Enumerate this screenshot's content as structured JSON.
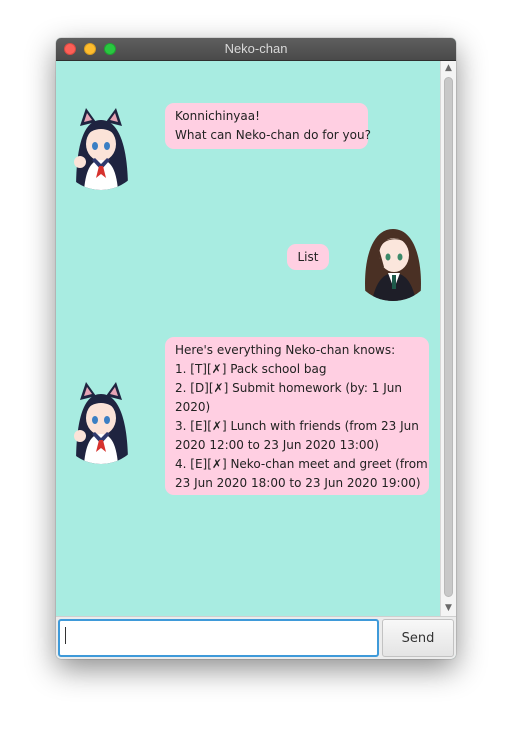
{
  "window": {
    "title": "Neko-chan"
  },
  "messages": [
    {
      "sender": "bot",
      "lines": [
        "Konnichinyaa!",
        "What can Neko-chan do for you?"
      ]
    },
    {
      "sender": "user",
      "lines": [
        "List"
      ]
    },
    {
      "sender": "bot",
      "lines": [
        "Here's everything Neko-chan knows:",
        "1. [T][✗] Pack school bag",
        "2. [D][✗] Submit homework (by: 1 Jun",
        "2020)",
        "3. [E][✗] Lunch with friends (from 23 Jun",
        "2020 12:00 to 23 Jun 2020 13:00)",
        "4. [E][✗] Neko-chan meet and greet (from",
        "23 Jun 2020 18:00 to 23 Jun 2020 19:00)"
      ]
    }
  ],
  "input": {
    "value": "",
    "placeholder": ""
  },
  "send_button": {
    "label": "Send"
  },
  "colors": {
    "chat_background": "#a8ece1",
    "bubble": "#ffcfe2",
    "titlebar": "#4a4a4a",
    "input_focus": "#3f9ad9"
  },
  "icons": {
    "bot_avatar": "catgirl-avatar",
    "user_avatar": "brown-hair-girl-avatar"
  }
}
